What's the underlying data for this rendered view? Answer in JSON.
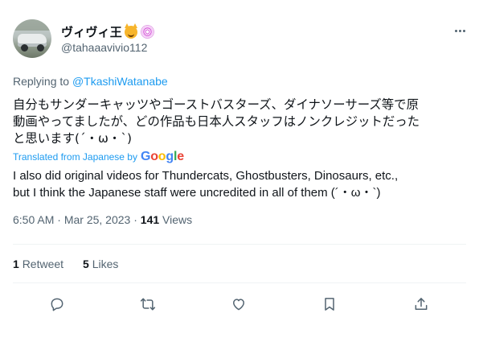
{
  "author": {
    "display_name": "ヴィヴィ王",
    "handle": "@tahaaavivio112",
    "avatar_icon": "avatar-car-photo"
  },
  "reply_context": {
    "prefix": "Replying to",
    "mention": "@TkashiWatanabe"
  },
  "tweet": {
    "original_lines": [
      "自分もサンダーキャッツやゴーストバスターズ、ダイナソーサーズ等で原",
      "動画やってましたが、どの作品も日本人スタッフはノンクレジットだった",
      "と思います(´・ω・`)"
    ],
    "translated_by_label": "Translated from Japanese by",
    "translation_provider": "Google",
    "translation_lines": [
      "I also did original videos for Thundercats, Ghostbusters, Dinosaurs, etc.,",
      "but I think the Japanese staff were uncredited in all of them (´・ω・`)"
    ]
  },
  "meta": {
    "time": "6:50 AM",
    "separator": "·",
    "date": "Mar 25, 2023",
    "views_count": "141",
    "views_label": "Views"
  },
  "stats": {
    "retweets_count": "1",
    "retweets_label": "Retweet",
    "likes_count": "5",
    "likes_label": "Likes"
  },
  "actions": [
    "reply-icon",
    "retweet-icon",
    "like-icon",
    "bookmark-icon",
    "share-icon"
  ],
  "colors": {
    "accent": "#1d9bf0",
    "secondary_text": "#536471",
    "primary_text": "#0f1419"
  }
}
